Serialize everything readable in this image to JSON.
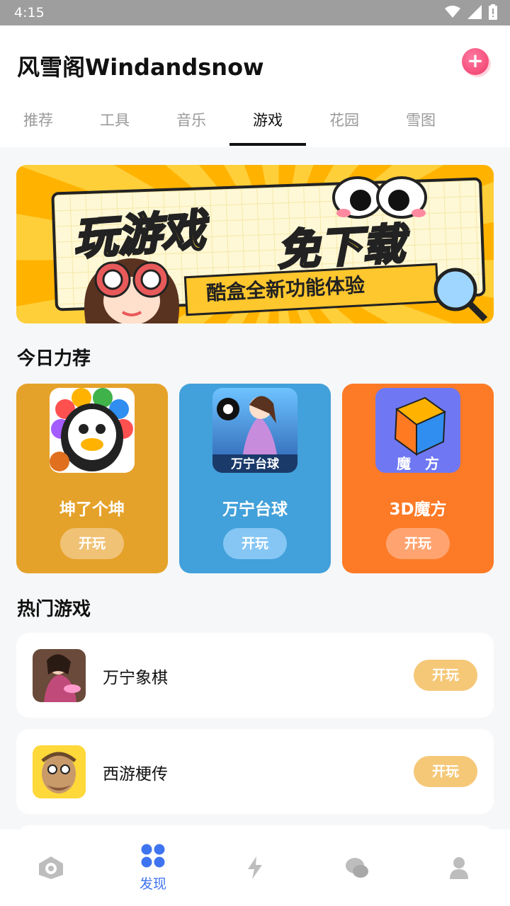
{
  "status": {
    "time": "4:15"
  },
  "header": {
    "title": "风雪阁Windandsnow"
  },
  "tabs": [
    {
      "label": "推荐"
    },
    {
      "label": "工具"
    },
    {
      "label": "音乐"
    },
    {
      "label": "游戏"
    },
    {
      "label": "花园"
    },
    {
      "label": "雪图"
    }
  ],
  "active_tab": "游戏",
  "banner": {
    "title1": "玩游戏",
    "title2": "免下载",
    "subtitle": "酷盒全新功能体验"
  },
  "today": {
    "title": "今日力荐",
    "cards": [
      {
        "name": "坤了个坤",
        "play": "开玩",
        "color": "#e5a22a",
        "btn": "#f0c276"
      },
      {
        "name": "万宁台球",
        "play": "开玩",
        "color": "#42a0da",
        "btn": "#85c6f4"
      },
      {
        "name": "3D魔方",
        "play": "开玩",
        "color": "#fd7a26",
        "btn": "#ffa470"
      }
    ]
  },
  "hot": {
    "title": "热门游戏",
    "items": [
      {
        "name": "万宁象棋",
        "play": "开玩"
      },
      {
        "name": "西游梗传",
        "play": "开玩"
      }
    ]
  },
  "bottom_nav": {
    "items": [
      {
        "icon": "camera-icon"
      },
      {
        "icon": "grid-icon",
        "label": "发现"
      },
      {
        "icon": "lightning-icon"
      },
      {
        "icon": "chat-icon"
      },
      {
        "icon": "user-icon"
      }
    ],
    "active_color": "#3f74f0",
    "inactive_color": "#bdbdbd"
  }
}
